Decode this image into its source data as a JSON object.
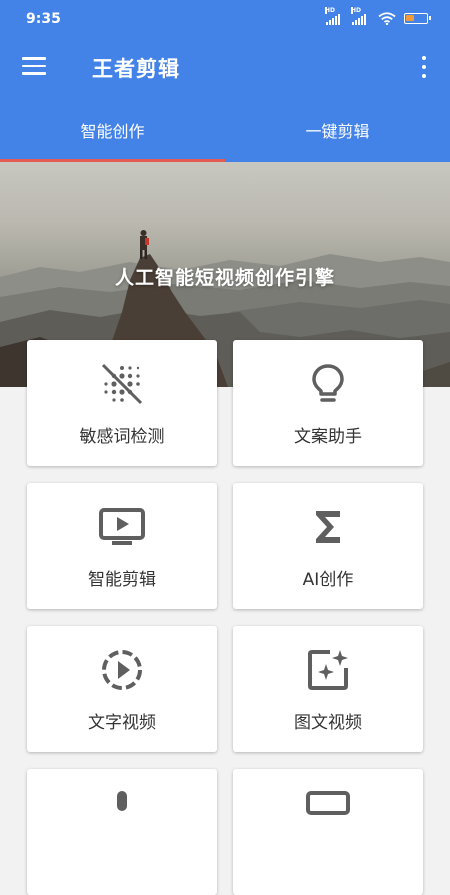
{
  "status": {
    "time": "9:35",
    "hd1": "HD",
    "hd2": "HD",
    "battery_color": "#f39c3c",
    "battery_level": 0.45
  },
  "appbar": {
    "title": "王者剪辑",
    "menu_icon": "hamburger-menu-icon",
    "more_icon": "more-vert-icon"
  },
  "tabs": [
    {
      "label": "智能创作",
      "active": true
    },
    {
      "label": "一键剪辑",
      "active": false
    }
  ],
  "banner": {
    "text": "人工智能短视频创作引擎"
  },
  "features": [
    {
      "label": "敏感词检测",
      "icon": "blur-off-icon"
    },
    {
      "label": "文案助手",
      "icon": "lightbulb-icon"
    },
    {
      "label": "智能剪辑",
      "icon": "tv-play-icon"
    },
    {
      "label": "AI创作",
      "icon": "sigma-icon"
    },
    {
      "label": "文字视频",
      "icon": "slow-motion-video-icon"
    },
    {
      "label": "图文视频",
      "icon": "auto-awesome-image-icon"
    },
    {
      "label": "",
      "icon": "mic-icon"
    },
    {
      "label": "",
      "icon": "monitor-icon"
    }
  ],
  "colors": {
    "primary": "#4383e8",
    "tab_indicator": "#e35b52",
    "icon_gray": "#5f5f5f",
    "background": "#f2f2f2"
  }
}
